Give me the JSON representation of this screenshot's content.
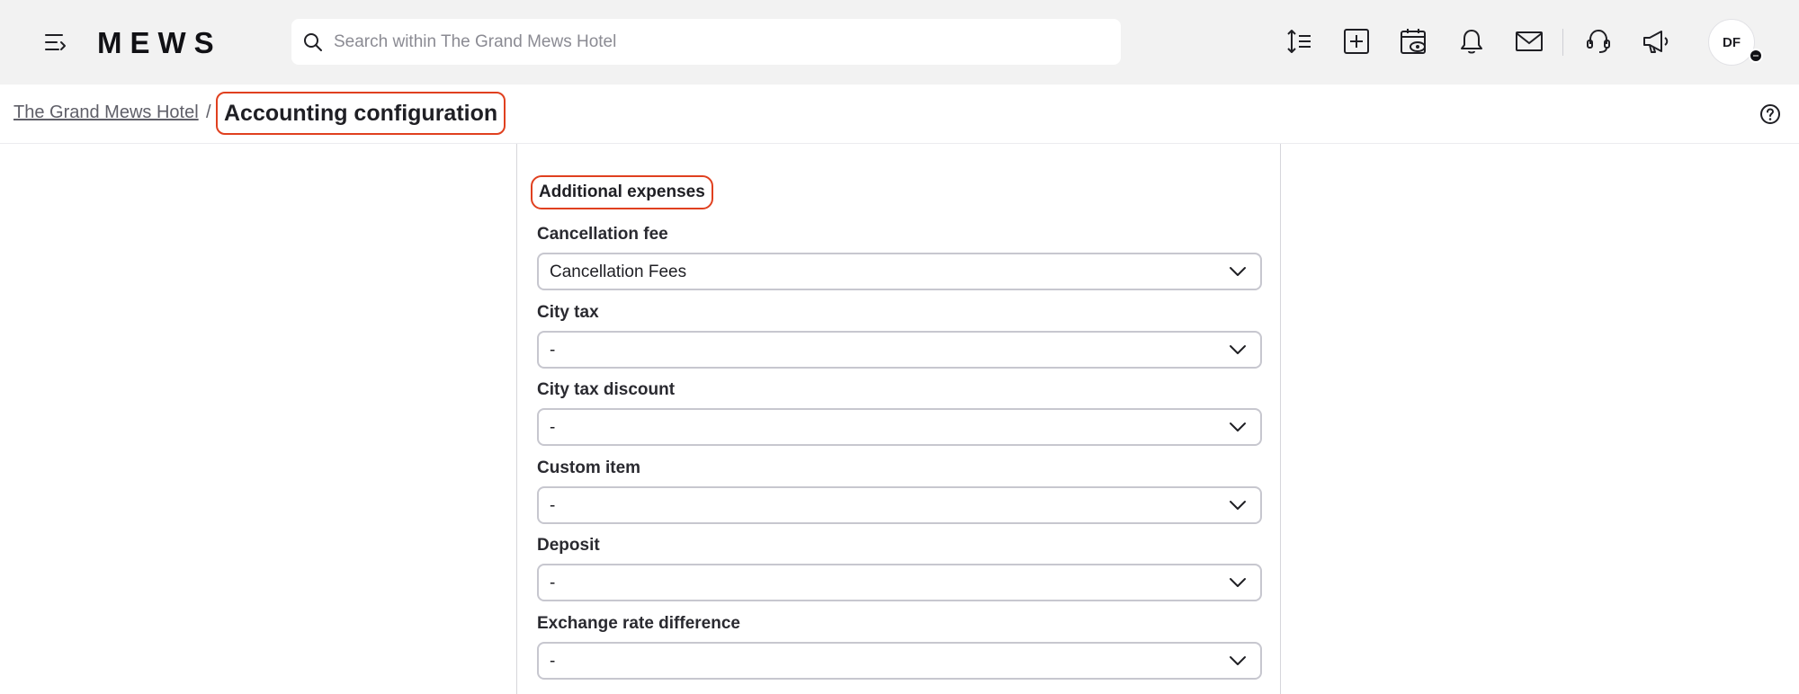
{
  "header": {
    "logo_text": "MEWS",
    "search_placeholder": "Search within The Grand Mews Hotel",
    "search_value": "",
    "icons": [
      "menu-icon",
      "sort-icon",
      "add-icon",
      "calendar-view-icon",
      "bell-icon",
      "mail-icon",
      "support-icon",
      "announcement-icon"
    ],
    "avatar_initials": "DF"
  },
  "breadcrumb": {
    "parent": "The Grand Mews Hotel",
    "separator": "/",
    "current": "Accounting configuration"
  },
  "section": {
    "title": "Additional expenses",
    "fields": [
      {
        "label": "Cancellation fee",
        "value": "Cancellation Fees"
      },
      {
        "label": "City tax",
        "value": "-"
      },
      {
        "label": "City tax discount",
        "value": "-"
      },
      {
        "label": "Custom item",
        "value": "-"
      },
      {
        "label": "Deposit",
        "value": "-"
      },
      {
        "label": "Exchange rate difference",
        "value": "-"
      }
    ]
  },
  "colors": {
    "highlight": "#e0401f",
    "topbar_bg": "#f2f2f2"
  }
}
